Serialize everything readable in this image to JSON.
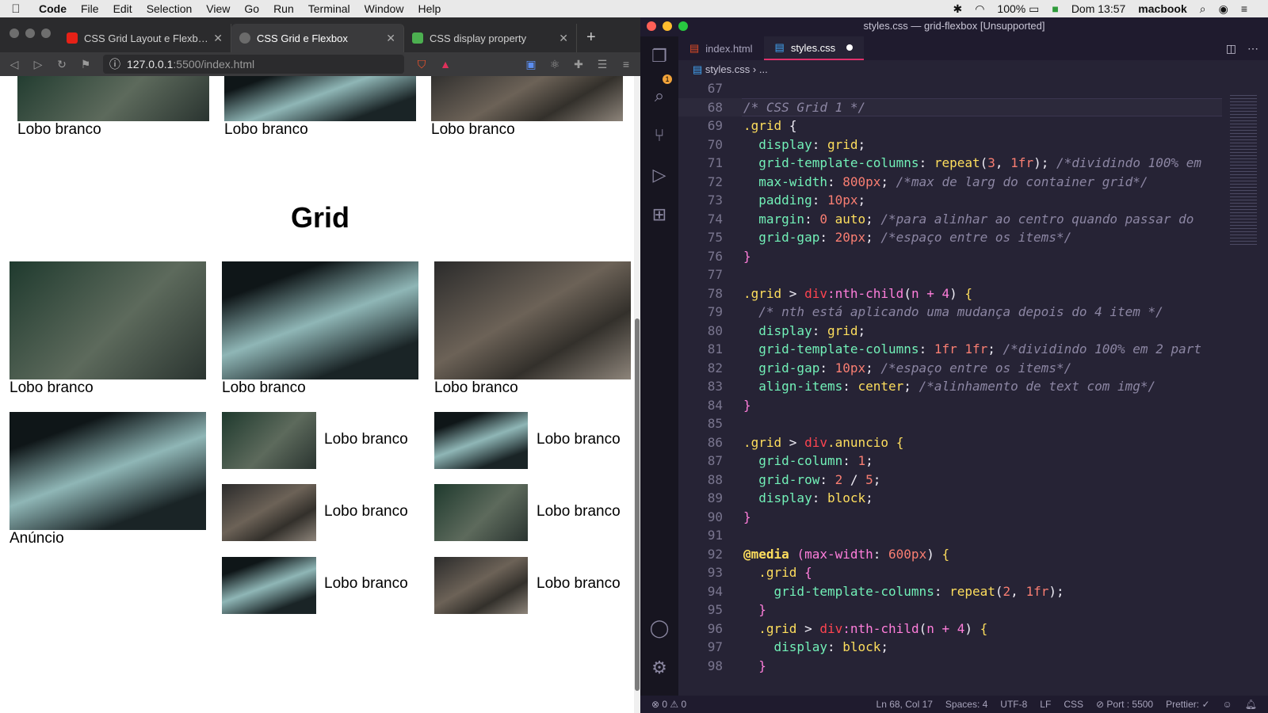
{
  "menubar": {
    "apple": "",
    "app": "Code",
    "items": [
      "File",
      "Edit",
      "Selection",
      "View",
      "Go",
      "Run",
      "Terminal",
      "Window",
      "Help"
    ],
    "battery": "100%",
    "clock": "Dom 13:57",
    "user": "macbook"
  },
  "browser": {
    "tabs": [
      {
        "title": "CSS Grid Layout e Flexbox - ",
        "fav_color": "#e62117"
      },
      {
        "title": "CSS Grid e Flexbox",
        "fav_color": "#6b6b6b"
      },
      {
        "title": "CSS display property",
        "fav_color": "#4caf50"
      }
    ],
    "url_host": "127.0.0.1",
    "url_rest": ":5500/index.html"
  },
  "page": {
    "top_captions": [
      "Lobo branco",
      "Lobo branco",
      "Lobo branco"
    ],
    "heading": "Grid",
    "row1_captions": [
      "Lobo branco",
      "Lobo branco",
      "Lobo branco"
    ],
    "ad_caption": "Anúncio",
    "small_captions": [
      "Lobo branco",
      "Lobo branco",
      "Lobo branco",
      "Lobo branco",
      "Lobo branco",
      "Lobo branco"
    ]
  },
  "vscode": {
    "window_title": "styles.css — grid-flexbox [Unsupported]",
    "tabs": [
      "index.html",
      "styles.css"
    ],
    "breadcrumb_file": "styles.css",
    "breadcrumb_rest": "...",
    "status": {
      "problems": "⊗ 0 ⚠ 0",
      "position": "Ln 68, Col 17",
      "spaces": "Spaces: 4",
      "encoding": "UTF-8",
      "eol": "LF",
      "lang": "CSS",
      "port": "⊘ Port : 5500",
      "prettier": "Prettier: ✓"
    },
    "code_lines": [
      {
        "n": "67",
        "html": ""
      },
      {
        "n": "68",
        "html": "<span class='t-com'>/* CSS Grid 1 */</span>",
        "cur": true
      },
      {
        "n": "69",
        "html": "<span class='t-sel'>.grid</span> <span class='t-pun'>{</span>"
      },
      {
        "n": "70",
        "html": "  <span class='t-prop'>display</span>: <span class='t-val'>grid</span>;"
      },
      {
        "n": "71",
        "html": "  <span class='t-prop'>grid-template-columns</span>: <span class='t-val'>repeat</span>(<span class='t-num'>3</span>, <span class='t-num'>1fr</span>); <span class='t-com'>/*dividindo 100% em</span>"
      },
      {
        "n": "72",
        "html": "  <span class='t-prop'>max-width</span>: <span class='t-num'>800px</span>; <span class='t-com'>/*max de larg do container grid*/</span>"
      },
      {
        "n": "73",
        "html": "  <span class='t-prop'>padding</span>: <span class='t-num'>10px</span>;"
      },
      {
        "n": "74",
        "html": "  <span class='t-prop'>margin</span>: <span class='t-num'>0</span> <span class='t-val'>auto</span>; <span class='t-com'>/*para alinhar ao centro quando passar do</span>"
      },
      {
        "n": "75",
        "html": "  <span class='t-prop'>grid-gap</span>: <span class='t-num'>20px</span>; <span class='t-com'>/*espaço entre os items*/</span>"
      },
      {
        "n": "76",
        "html": "<span class='t-pseudo'>}</span>"
      },
      {
        "n": "77",
        "html": ""
      },
      {
        "n": "78",
        "html": "<span class='t-sel'>.grid</span> &gt; <span class='t-fn'>div</span><span class='t-pseudo'>:nth-child</span>(<span class='t-pseudo'>n + 4</span>) <span class='t-val'>{</span>"
      },
      {
        "n": "79",
        "html": "  <span class='t-com'>/* nth está aplicando uma mudança depois do 4 item */</span>"
      },
      {
        "n": "80",
        "html": "  <span class='t-prop'>display</span>: <span class='t-val'>grid</span>;"
      },
      {
        "n": "81",
        "html": "  <span class='t-prop'>grid-template-columns</span>: <span class='t-num'>1fr 1fr</span>; <span class='t-com'>/*dividindo 100% em 2 part</span>"
      },
      {
        "n": "82",
        "html": "  <span class='t-prop'>grid-gap</span>: <span class='t-num'>10px</span>; <span class='t-com'>/*espaço entre os items*/</span>"
      },
      {
        "n": "83",
        "html": "  <span class='t-prop'>align-items</span>: <span class='t-val'>center</span>; <span class='t-com'>/*alinhamento de text com img*/</span>"
      },
      {
        "n": "84",
        "html": "<span class='t-pseudo'>}</span>"
      },
      {
        "n": "85",
        "html": ""
      },
      {
        "n": "86",
        "html": "<span class='t-sel'>.grid</span> &gt; <span class='t-fn'>div</span><span class='t-sel'>.anuncio</span> <span class='t-val'>{</span>"
      },
      {
        "n": "87",
        "html": "  <span class='t-prop'>grid-column</span>: <span class='t-num'>1</span>;"
      },
      {
        "n": "88",
        "html": "  <span class='t-prop'>grid-row</span>: <span class='t-num'>2</span> / <span class='t-num'>5</span>;"
      },
      {
        "n": "89",
        "html": "  <span class='t-prop'>display</span>: <span class='t-val'>block</span>;"
      },
      {
        "n": "90",
        "html": "<span class='t-pseudo'>}</span>"
      },
      {
        "n": "91",
        "html": ""
      },
      {
        "n": "92",
        "html": "<span class='t-kw'>@media</span> <span class='t-pseudo'>(max-width</span>: <span class='t-num'>600px</span>) <span class='t-val'>{</span>"
      },
      {
        "n": "93",
        "html": "  <span class='t-sel'>.grid</span> <span class='t-pseudo'>{</span>"
      },
      {
        "n": "94",
        "html": "    <span class='t-prop'>grid-template-columns</span>: <span class='t-val'>repeat</span>(<span class='t-num'>2</span>, <span class='t-num'>1fr</span>);"
      },
      {
        "n": "95",
        "html": "  <span class='t-pseudo'>}</span>"
      },
      {
        "n": "96",
        "html": "  <span class='t-sel'>.grid</span> &gt; <span class='t-fn'>div</span><span class='t-pseudo'>:nth-child</span>(<span class='t-pseudo'>n + 4</span>) <span class='t-val'>{</span>"
      },
      {
        "n": "97",
        "html": "    <span class='t-prop'>display</span>: <span class='t-val'>block</span>;"
      },
      {
        "n": "98",
        "html": "  <span class='t-pseudo'>}</span>"
      }
    ]
  }
}
